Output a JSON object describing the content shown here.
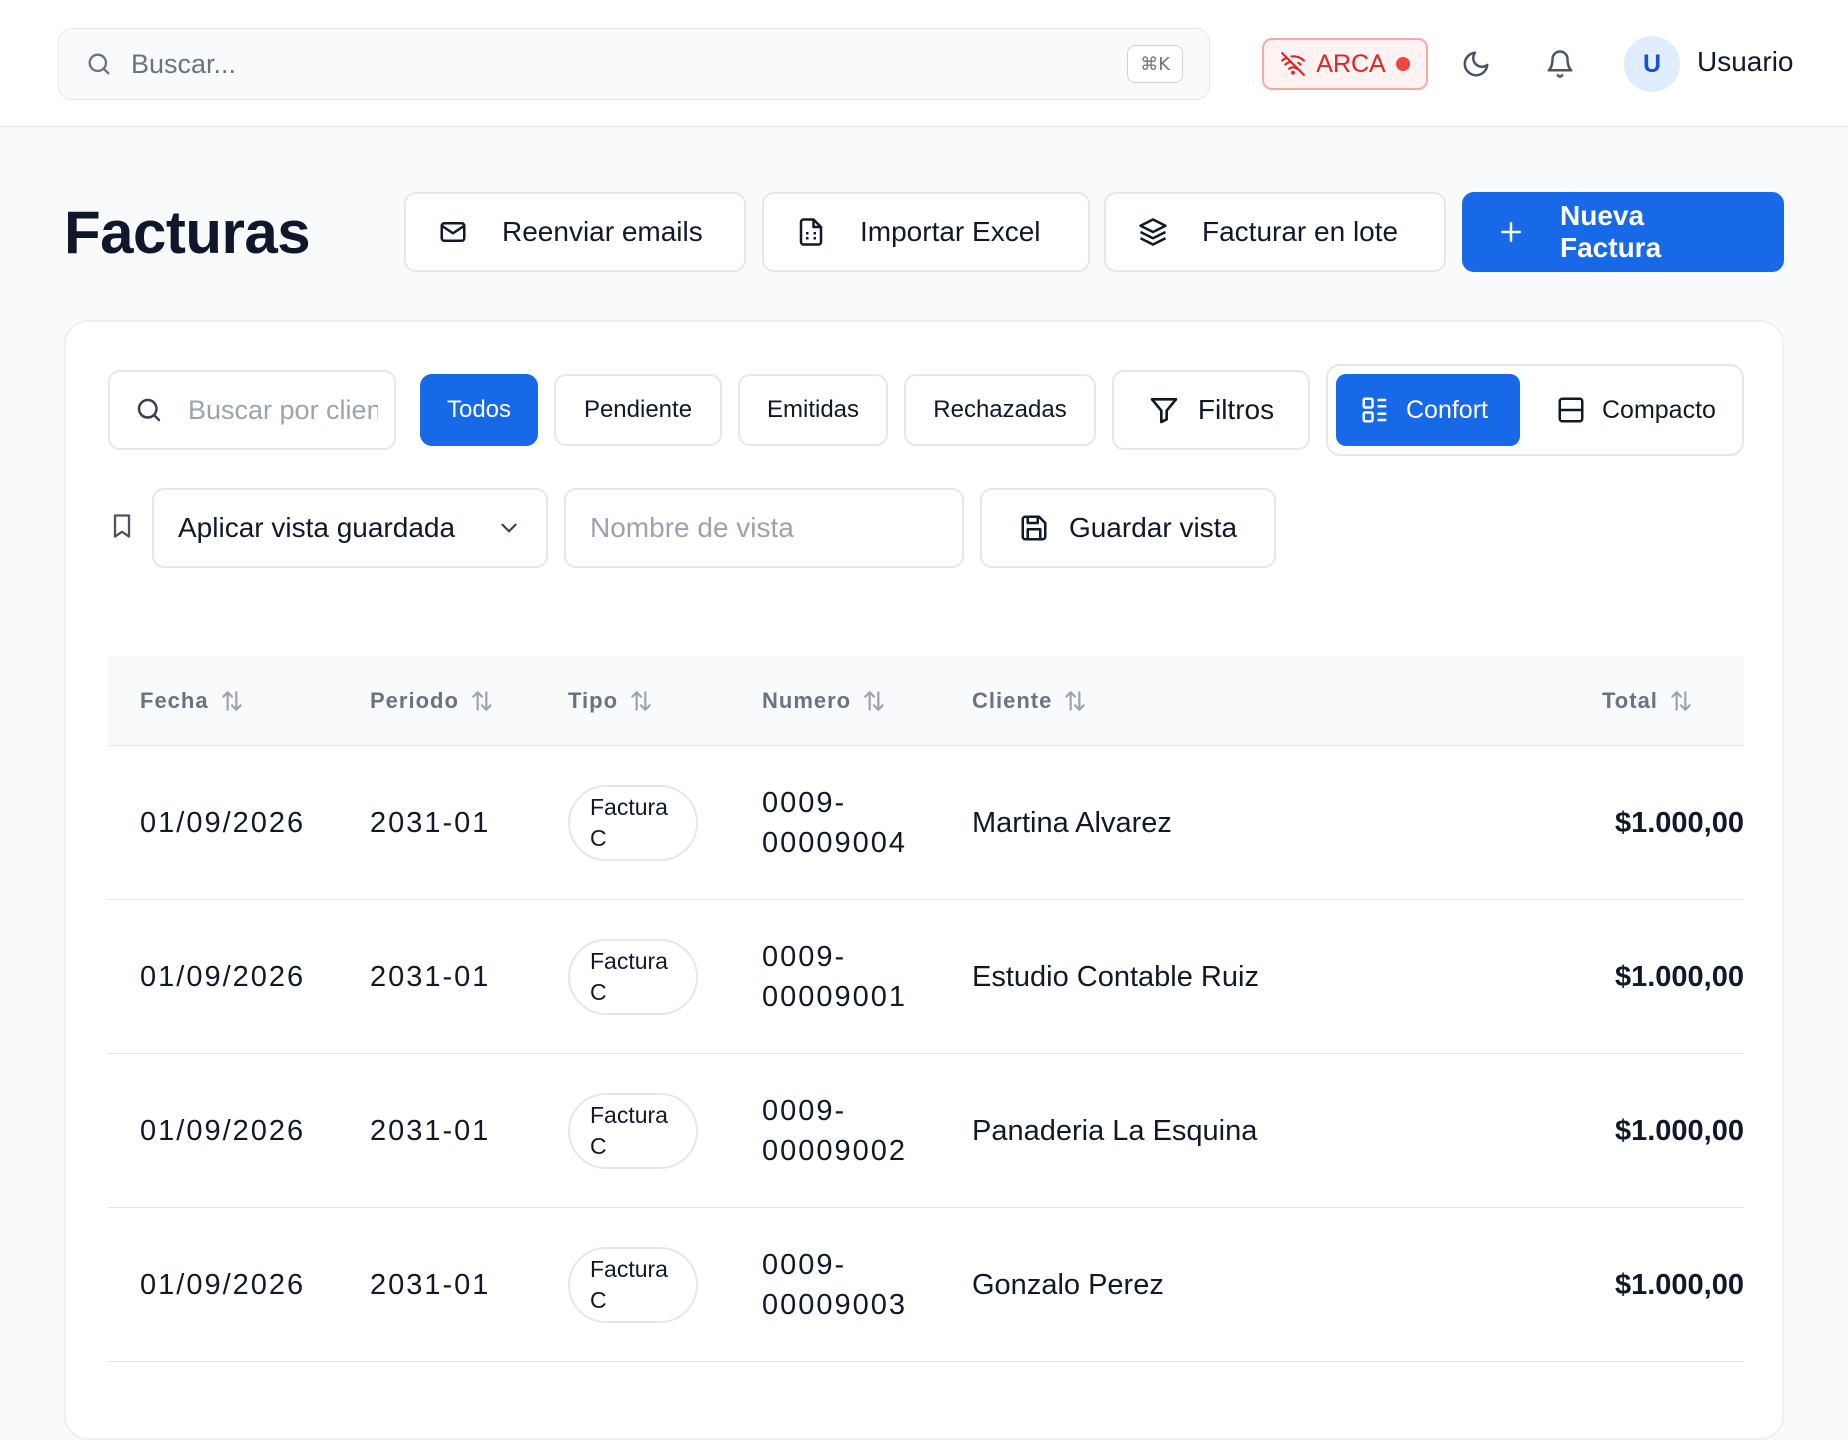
{
  "topbar": {
    "search_placeholder": "Buscar...",
    "shortcut": "⌘K",
    "arca_label": "ARCA",
    "user_initial": "U",
    "user_name": "Usuario"
  },
  "page": {
    "title": "Facturas",
    "actions": {
      "resend_emails": "Reenviar emails",
      "import_excel": "Importar Excel",
      "batch_invoice": "Facturar en lote",
      "new_invoice": "Nueva Factura"
    }
  },
  "toolbar": {
    "search_placeholder": "Buscar por cliente",
    "status_filters": [
      "Todos",
      "Pendiente",
      "Emitidas",
      "Rechazadas"
    ],
    "active_filter": "Todos",
    "filters_label": "Filtros",
    "density": {
      "comfort": "Confort",
      "compact": "Compacto",
      "selected": "Confort"
    },
    "saved_view_label": "Aplicar vista guardada",
    "view_name_placeholder": "Nombre de vista",
    "save_view_label": "Guardar vista"
  },
  "table": {
    "columns": [
      "Fecha",
      "Periodo",
      "Tipo",
      "Numero",
      "Cliente",
      "Total"
    ],
    "rows": [
      {
        "fecha": "01/09/2026",
        "periodo": "2031-01",
        "tipo_1": "Factura",
        "tipo_2": "C",
        "numero_1": "0009-",
        "numero_2": "00009004",
        "cliente": "Martina Alvarez",
        "total": "$1.000,00"
      },
      {
        "fecha": "01/09/2026",
        "periodo": "2031-01",
        "tipo_1": "Factura",
        "tipo_2": "C",
        "numero_1": "0009-",
        "numero_2": "00009001",
        "cliente": "Estudio Contable Ruiz",
        "total": "$1.000,00"
      },
      {
        "fecha": "01/09/2026",
        "periodo": "2031-01",
        "tipo_1": "Factura",
        "tipo_2": "C",
        "numero_1": "0009-",
        "numero_2": "00009002",
        "cliente": "Panaderia La Esquina",
        "total": "$1.000,00"
      },
      {
        "fecha": "01/09/2026",
        "periodo": "2031-01",
        "tipo_1": "Factura",
        "tipo_2": "C",
        "numero_1": "0009-",
        "numero_2": "00009003",
        "cliente": "Gonzalo Perez",
        "total": "$1.000,00"
      }
    ]
  },
  "colors": {
    "primary": "#1769e8",
    "danger": "#dc2626",
    "border": "#e5e7eb"
  },
  "icons": [
    "search-icon",
    "wifi-off-icon",
    "moon-icon",
    "bell-icon",
    "mail-icon",
    "file-spreadsheet-icon",
    "layers-icon",
    "plus-icon",
    "filter-icon",
    "list-layout-icon",
    "rows-layout-icon",
    "bookmark-icon",
    "chevron-down-icon",
    "save-icon",
    "sort-icon"
  ]
}
